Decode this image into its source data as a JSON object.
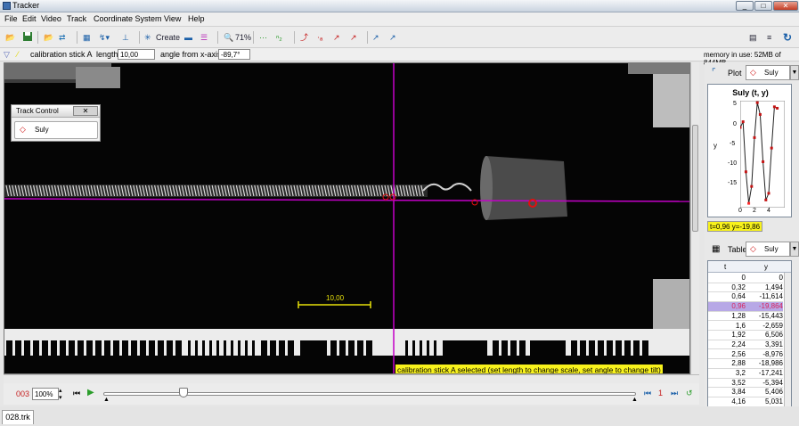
{
  "window": {
    "title": "Tracker",
    "min": "_",
    "max": "□",
    "close": "✕"
  },
  "menu": [
    "File",
    "Edit",
    "Video",
    "Track",
    "Coordinate System",
    "View",
    "Help"
  ],
  "toolbar": {
    "create_label": "Create",
    "zoom_label": "71%"
  },
  "props": {
    "track_label": "calibration stick A",
    "length_label": "length",
    "length_value": "10,00",
    "angle_label": "angle from x-axis",
    "angle_value": "-89,7°",
    "memory": "memory in use: 52MB of 844MB"
  },
  "track_control": {
    "title": "Track Control",
    "close": "✕",
    "item": "Suly"
  },
  "video": {
    "stick_label": "10,00",
    "status_message": "calibration stick A selected (set length to change scale, set angle to change tilt)",
    "colors": {
      "axis": "#c400c8",
      "stick": "#e6e00a",
      "point": "#e01010"
    }
  },
  "player": {
    "frame": "003",
    "zoom": "100%",
    "step": "1",
    "slider_value": 0.15
  },
  "file_tab": "028.trk",
  "plot": {
    "tab_label": "Plot",
    "track_label": "Suly",
    "title": "Suly (t, y)",
    "readout": "t=0,96  y=-19,86",
    "ylabel": "y",
    "yticks": [
      "5",
      "0",
      "-5",
      "-10",
      "-15"
    ],
    "xticks": [
      "0",
      "2",
      "4"
    ]
  },
  "table": {
    "tab_label": "Table",
    "track_label": "Suly",
    "columns": [
      "t",
      "y"
    ],
    "rows": [
      [
        "0",
        "0"
      ],
      [
        "0,32",
        "1,494"
      ],
      [
        "0,64",
        "-11,614"
      ],
      [
        "0,96",
        "-19,864"
      ],
      [
        "1,28",
        "-15,443"
      ],
      [
        "1,6",
        "-2,659"
      ],
      [
        "1,92",
        "6,506"
      ],
      [
        "2,24",
        "3,391"
      ],
      [
        "2,56",
        "-8,976"
      ],
      [
        "2,88",
        "-18,986"
      ],
      [
        "3,2",
        "-17,241"
      ],
      [
        "3,52",
        "-5,394"
      ],
      [
        "3,84",
        "5,406"
      ],
      [
        "4,16",
        "5,031"
      ]
    ],
    "selected_index": 3
  }
}
